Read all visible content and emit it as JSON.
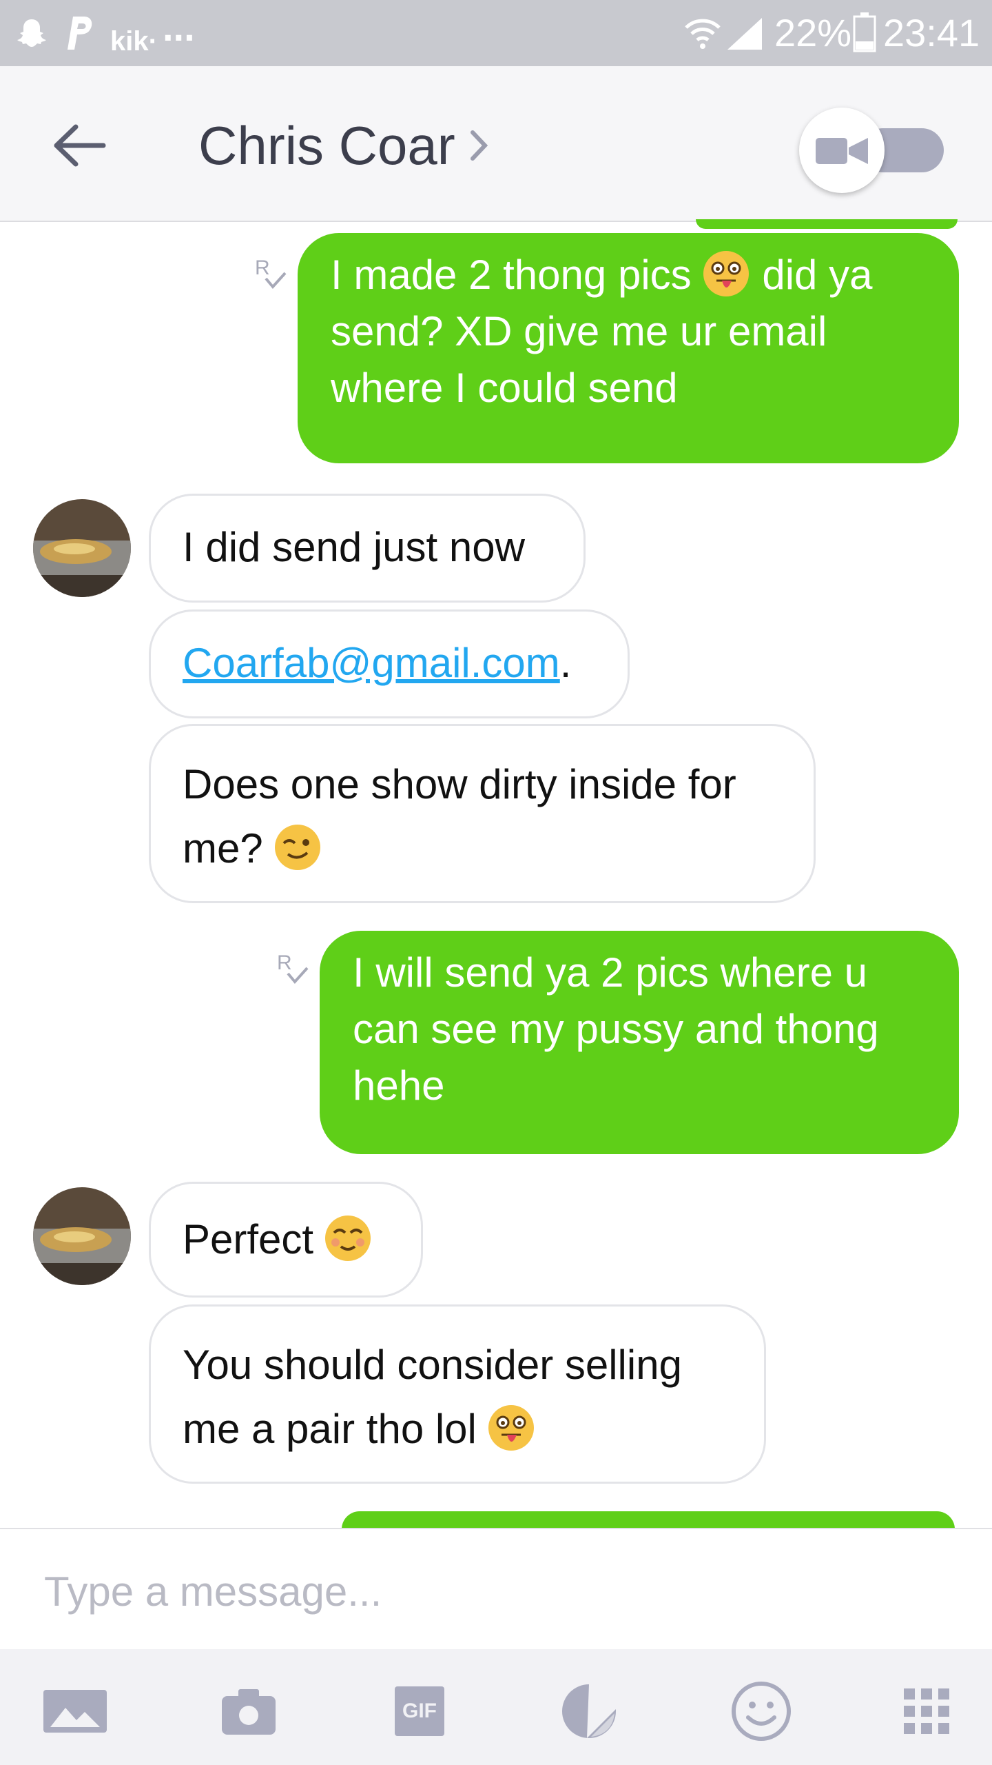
{
  "status_bar": {
    "notification_icons": [
      "snapchat-icon",
      "paypal-icon",
      "kik-icon",
      "more-icon"
    ],
    "kik_text": "kik·",
    "more_text": "...",
    "battery": "22%",
    "time": "23:41"
  },
  "header": {
    "contact_name": "Chris Coar",
    "video_chat_toggle": "off"
  },
  "messages": [
    {
      "from": "me",
      "lines": [
        "I made 2 thong pics",
        "send? XD give me ur email",
        "where I could send"
      ],
      "line1_tail": "did ya",
      "emoji": "tongue-out-emoji",
      "receipt": "R"
    },
    {
      "from": "Chris Coar",
      "text": "I did send just now"
    },
    {
      "from": "Chris Coar",
      "link": "Coarfab@gmail.com",
      "suffix": "."
    },
    {
      "from": "Chris Coar",
      "lines": [
        "Does one show dirty inside for",
        "me?"
      ],
      "emoji": "wink-emoji"
    },
    {
      "from": "me",
      "lines": [
        "I will send ya 2 pics where u",
        "can see my pussy and thong",
        "hehe"
      ],
      "receipt": "R"
    },
    {
      "from": "Chris Coar",
      "text": "Perfect",
      "emoji": "blush-emoji"
    },
    {
      "from": "Chris Coar",
      "lines": [
        "You should consider selling",
        "me a pair tho lol"
      ],
      "emoji": "tongue-out-emoji"
    }
  ],
  "composer": {
    "placeholder": "Type a message..."
  },
  "toolbar": {
    "items": [
      "gallery-icon",
      "camera-icon",
      "gif-icon",
      "sticker-icon",
      "emoji-icon",
      "apps-grid-icon"
    ],
    "gif_label": "GIF"
  },
  "colors": {
    "outgoing_bubble": "#5fcf18",
    "incoming_border": "#e3e4e8",
    "link": "#22a7f0",
    "status_bar": "#c8c9cf",
    "header_text": "#3c3e4c"
  }
}
